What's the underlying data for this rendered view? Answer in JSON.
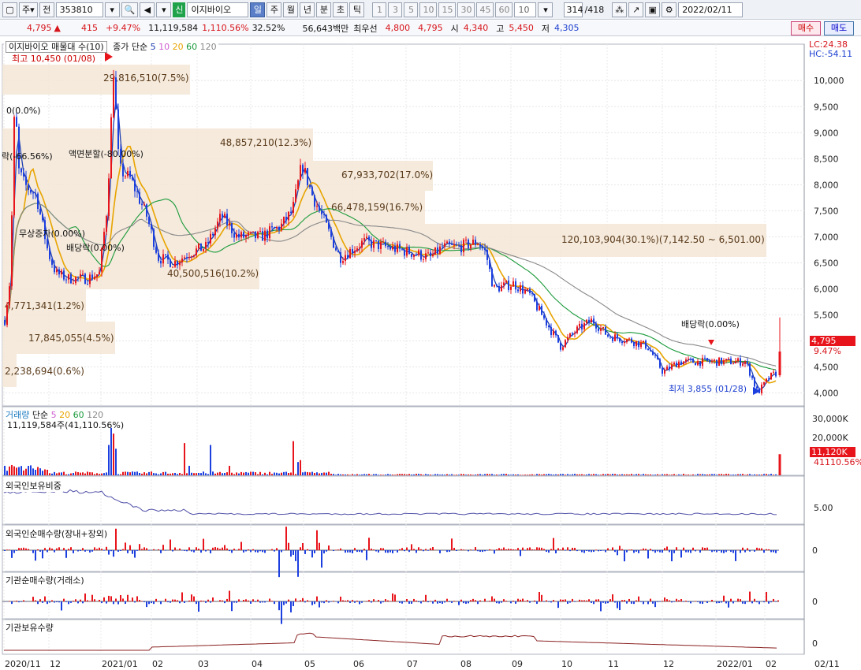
{
  "toolbar": {
    "market": "주",
    "prev": "전",
    "code": "353810",
    "badge": "신",
    "name": "이지바이오",
    "periods": [
      "일",
      "주",
      "월",
      "년",
      "분",
      "초",
      "틱"
    ],
    "numbers": [
      "1",
      "3",
      "5",
      "10",
      "15",
      "30",
      "45",
      "60"
    ],
    "count": "10",
    "page": "314",
    "total": "/418",
    "date": "2022/02/11"
  },
  "quote": {
    "price": "4,795",
    "change": "415",
    "rate": "+9.47%",
    "volume": "11,119,584",
    "vol_rate": "1,110.56%",
    "turnover": "32.52%",
    "amount": "56,643백만",
    "best_label": "최우선",
    "ask": "4,800",
    "bid": "4,795",
    "open_label": "시",
    "open": "4,340",
    "high_label": "고",
    "high": "5,450",
    "low_label": "저",
    "low": "4,305",
    "buy": "매수",
    "sell": "매도"
  },
  "legend": {
    "price_title": "이지바이오 매물대 수(10)",
    "ma_title": "종가 단순",
    "ma_periods": [
      "5",
      "10",
      "20",
      "60",
      "120"
    ],
    "vol_title": "거래량",
    "vol_ma": "단순",
    "vol_info": "11,119,584주(41,110.56%)",
    "lc": "LC:24.38",
    "hc": "HC:-54.11"
  },
  "annotations": {
    "high": "최고 10,450 (01/08)",
    "low": "최저 3,855 (01/28)",
    "dividend": "배당락(0.00%)",
    "dividend2": "배당락(0.00%)",
    "split": "액면분할(-80.00%)",
    "bonus": "무상증자(0.00%)",
    "left1": "0(0.0%)",
    "left2": "락(-66.56%)"
  },
  "volume_profile": [
    {
      "label": "29,816,510(7.5%)"
    },
    {
      "label": "48,857,210(12.3%)"
    },
    {
      "label": "67,933,702(17.0%)"
    },
    {
      "label": "66,478,159(16.7%)"
    },
    {
      "label": "120,103,904(30.1%)(7,142.50 ~ 6,501.00)"
    },
    {
      "label": "40,500,516(10.2%)"
    },
    {
      "label": "4,771,341(1.2%)"
    },
    {
      "label": "17,845,055(4.5%)"
    },
    {
      "label": "2,238,694(0.6%)"
    }
  ],
  "price_axis": [
    "10,000",
    "9,500",
    "9,000",
    "8,500",
    "8,000",
    "7,500",
    "7,000",
    "6,500",
    "6,000",
    "5,500",
    "5,000",
    "4,500",
    "4,000"
  ],
  "price_tag": "4,795",
  "price_tag2": "9.47%",
  "vol_axis": [
    "30,000K",
    "20,000K"
  ],
  "vol_tag": "11,120K",
  "vol_tag2": "41110.56%",
  "panels": {
    "foreign_ratio": "외국인보유비중",
    "foreign_ratio_axis": "5.00",
    "foreign_net": "외국인순매수량(장내+장외)",
    "inst_net": "기관순매수량(거래소)",
    "inst_hold": "기관보유수량",
    "zero": "0"
  },
  "x_axis": [
    "2020/11",
    "12",
    "2021/01",
    "02",
    "03",
    "04",
    "05",
    "06",
    "07",
    "08",
    "09",
    "10",
    "11",
    "12",
    "2022/01",
    "02",
    "02/11"
  ],
  "colors": {
    "up": "#e8141b",
    "down": "#1c3fe0",
    "ma5": "#1f3fb0",
    "ma20": "#e8a400",
    "ma60": "#1a9a3a",
    "ma120": "#888888",
    "box": "#f3e6d6"
  }
}
